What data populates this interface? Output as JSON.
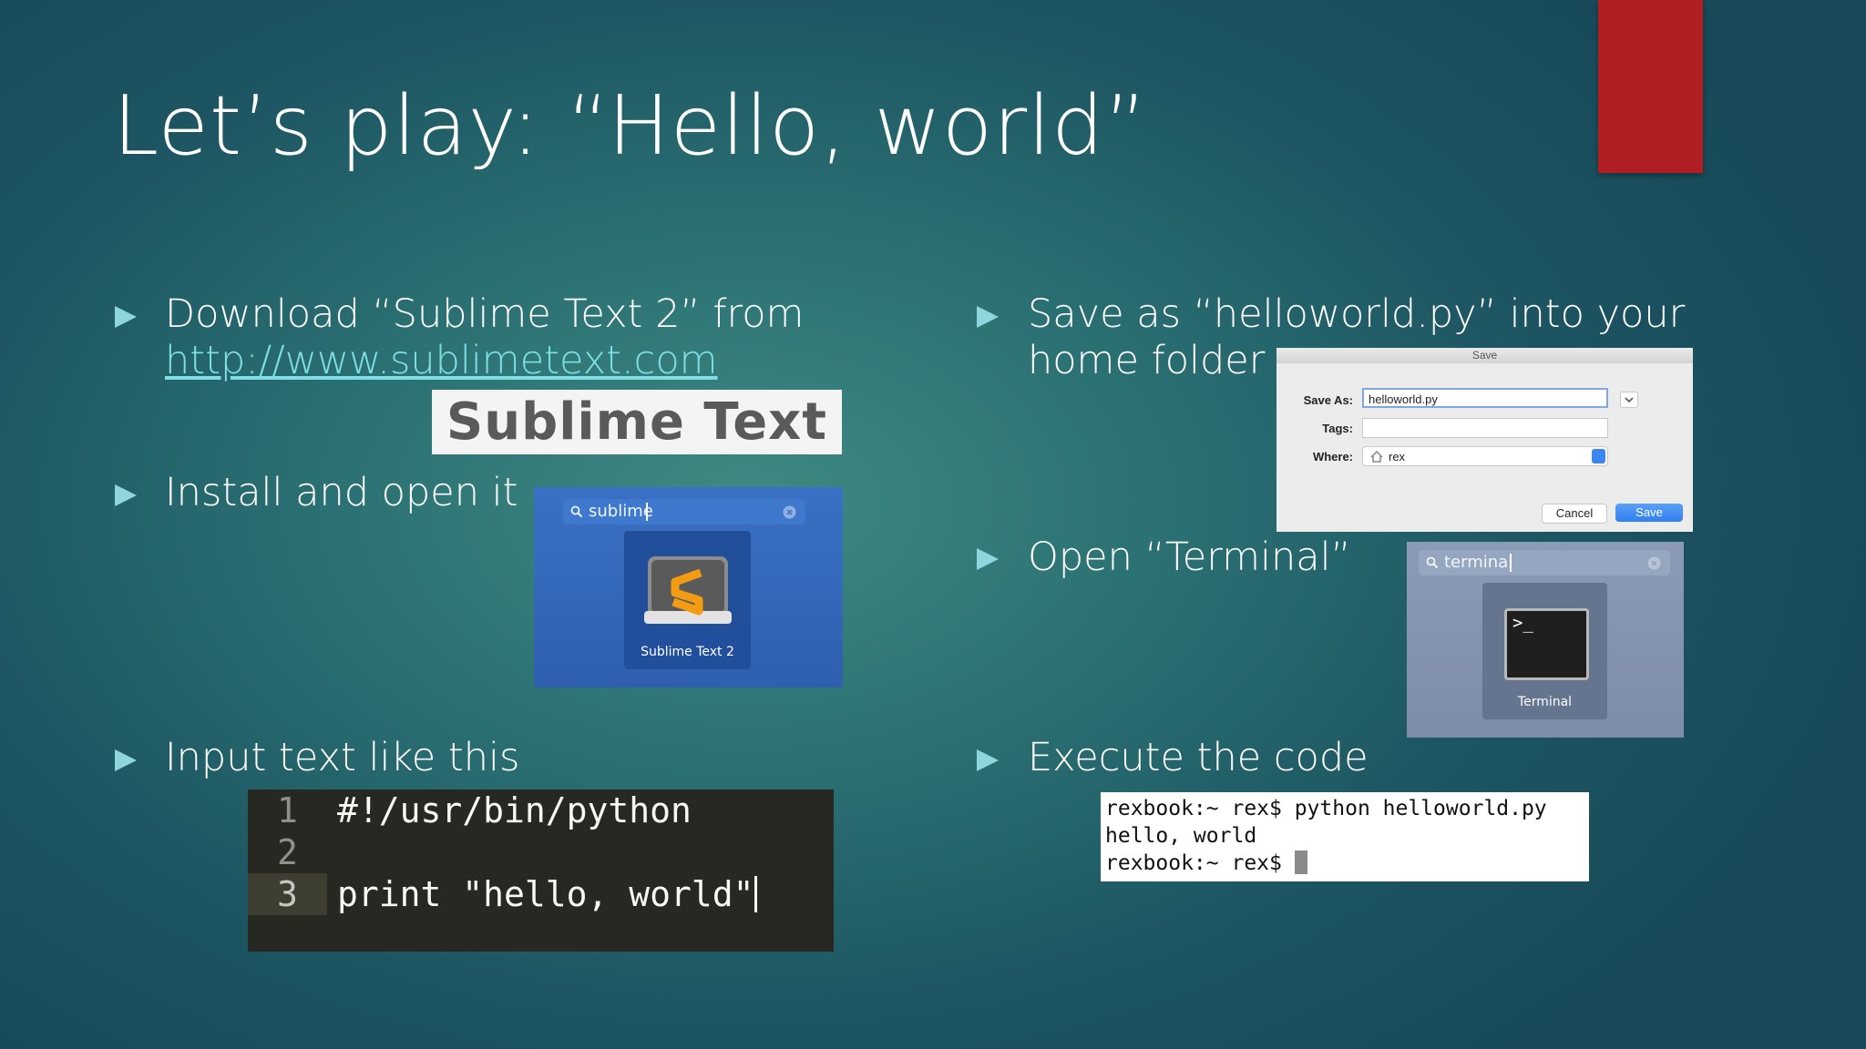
{
  "slide": {
    "title": "Let’s play: “Hello, world”",
    "accent_color": "#b01e22"
  },
  "bullets": {
    "download_line1": "Download “Sublime Text 2” from",
    "download_link": "http://www.sublimetext.com",
    "install": "Install and open it",
    "input": "Input text like this",
    "save_line1": "Save as “helloworld.py” into your",
    "save_line2": "home folder",
    "terminal": "Open “Terminal”",
    "execute": "Execute the code"
  },
  "sublime_logo": {
    "text": "Sublime Text"
  },
  "spotlight_sublime": {
    "query": "sublime",
    "result_label": "Sublime Text 2",
    "icon": "sublime-text-app-icon"
  },
  "save_dialog": {
    "title": "Save",
    "save_as_label": "Save As:",
    "save_as_value": "helloworld.py",
    "tags_label": "Tags:",
    "tags_value": "",
    "where_label": "Where:",
    "where_value": "rex",
    "cancel_label": "Cancel",
    "save_label": "Save"
  },
  "spotlight_terminal": {
    "query": "terminal",
    "result_label": "Terminal",
    "icon_glyph": ">_"
  },
  "code_editor": {
    "lines": [
      {
        "num": "1",
        "text": "#!/usr/bin/python"
      },
      {
        "num": "2",
        "text": ""
      },
      {
        "num": "3",
        "text": "print \"hello, world\""
      }
    ]
  },
  "terminal_output": {
    "line1": "rexbook:~ rex$ python helloworld.py",
    "line2": "hello, world",
    "line3": "rexbook:~ rex$ "
  }
}
